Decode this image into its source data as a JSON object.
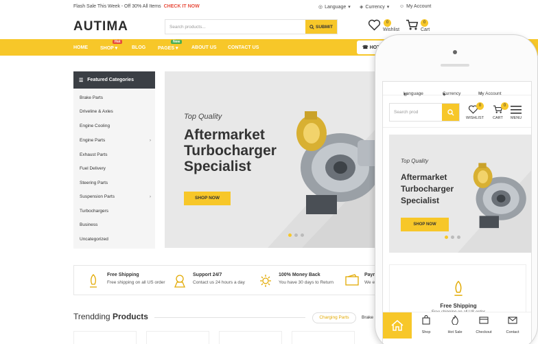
{
  "topbar": {
    "promo": "Flash Sale This Week - Off 30% All Items",
    "promo_cta": "CHECK IT NOW",
    "language": "Language",
    "currency": "Currency",
    "account": "My Account"
  },
  "header": {
    "logo": "AUTIMA",
    "search_placeholder": "Search products...",
    "search_button": "SUBMIT",
    "wishlist_label": "Wishlist",
    "wishlist_count": "0",
    "cart_label": "Cart",
    "cart_count": "0"
  },
  "nav": {
    "items": [
      "HOME",
      "SHOP",
      "BLOG",
      "PAGES",
      "ABOUT US",
      "CONTACT US"
    ],
    "shop_tag": "Hot",
    "pages_tag": "New",
    "hotline": "HOT"
  },
  "categories": {
    "title": "Featured Categories",
    "items": [
      "Brake Parts",
      "Driveline & Axles",
      "Engine Cooling",
      "Engine Parts",
      "Exhaust Parts",
      "Fuel Delivery",
      "Steering Parts",
      "Suspension Parts",
      "Turbochargers",
      "Business",
      "Uncategorized"
    ]
  },
  "hero": {
    "subtitle": "Top Quality",
    "title_line1": "Aftermarket",
    "title_line2": "Turbocharger",
    "title_line3": "Specialist",
    "button": "SHOP NOW"
  },
  "features": [
    {
      "title": "Free Shipping",
      "desc": "Free shipping on all US order"
    },
    {
      "title": "Support 24/7",
      "desc": "Contact us 24 hours a day"
    },
    {
      "title": "100% Money Back",
      "desc": "You have 30 days to Return"
    },
    {
      "title": "Payr",
      "desc": "We e"
    }
  ],
  "trending": {
    "title_light": "Trendding",
    "title_bold": "Products",
    "tab_active": "Charging Parts",
    "tab_next": "Brake"
  },
  "mobile": {
    "language": "Language",
    "currency": "Currency",
    "account": "My Account",
    "search_placeholder": "Search prod",
    "wishlist_label": "WISHLIST",
    "wishlist_count": "0",
    "cart_label": "CART",
    "cart_count": "0",
    "menu_label": "MENU",
    "hero_subtitle": "Top Quality",
    "hero_line1": "Aftermarket",
    "hero_line2": "Turbocharger",
    "hero_line3": "Specialist",
    "hero_button": "SHOP NOW",
    "feature_title": "Free Shipping",
    "feature_desc": "Free shipping on all US order",
    "bottom_tabs": [
      "Shop",
      "Hot Sale",
      "Checkout",
      "Contact"
    ]
  },
  "colors": {
    "accent": "#f7c729",
    "dark": "#3b3f45",
    "promo": "#e74c3c"
  }
}
